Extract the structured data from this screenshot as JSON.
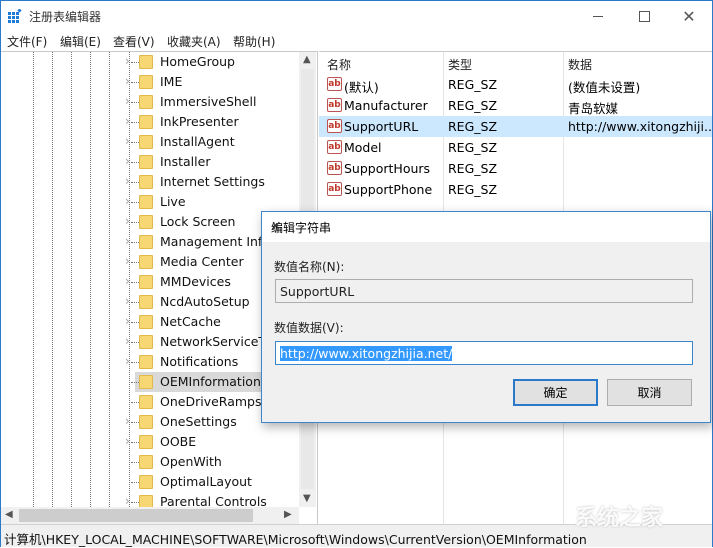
{
  "window": {
    "title": "注册表编辑器",
    "icon": "regedit-icon",
    "controls": [
      "minimize-icon",
      "maximize-icon",
      "close-icon"
    ]
  },
  "menu": [
    "文件(F)",
    "编辑(E)",
    "查看(V)",
    "收藏夹(A)",
    "帮助(H)"
  ],
  "tree": {
    "items": [
      {
        "label": "HomeGroup",
        "expandable": true
      },
      {
        "label": "IME",
        "expandable": true
      },
      {
        "label": "ImmersiveShell",
        "expandable": true
      },
      {
        "label": "InkPresenter",
        "expandable": true
      },
      {
        "label": "InstallAgent",
        "expandable": true
      },
      {
        "label": "Installer",
        "expandable": true
      },
      {
        "label": "Internet Settings",
        "expandable": true
      },
      {
        "label": "Live",
        "expandable": true
      },
      {
        "label": "Lock Screen",
        "expandable": true
      },
      {
        "label": "Management Infr",
        "expandable": true
      },
      {
        "label": "Media Center",
        "expandable": true
      },
      {
        "label": "MMDevices",
        "expandable": true
      },
      {
        "label": "NcdAutoSetup",
        "expandable": true
      },
      {
        "label": "NetCache",
        "expandable": true
      },
      {
        "label": "NetworkServiceTr",
        "expandable": true
      },
      {
        "label": "Notifications",
        "expandable": true
      },
      {
        "label": "OEMInformation",
        "expandable": false,
        "selected": true
      },
      {
        "label": "OneDriveRamps",
        "expandable": false
      },
      {
        "label": "OneSettings",
        "expandable": true
      },
      {
        "label": "OOBE",
        "expandable": true
      },
      {
        "label": "OpenWith",
        "expandable": false
      },
      {
        "label": "OptimalLayout",
        "expandable": false
      },
      {
        "label": "Parental Controls",
        "expandable": true
      }
    ]
  },
  "list": {
    "headers": [
      "名称",
      "类型",
      "数据"
    ],
    "rows": [
      {
        "name": "(默认)",
        "type": "REG_SZ",
        "data": "(数值未设置)"
      },
      {
        "name": "Manufacturer",
        "type": "REG_SZ",
        "data": "青岛软媒"
      },
      {
        "name": "SupportURL",
        "type": "REG_SZ",
        "data": "http://www.xitongzhiji...",
        "selected": true
      },
      {
        "name": "Model",
        "type": "REG_SZ",
        "data": ""
      },
      {
        "name": "SupportHours",
        "type": "REG_SZ",
        "data": ""
      },
      {
        "name": "SupportPhone",
        "type": "REG_SZ",
        "data": ""
      }
    ]
  },
  "status_path": "计算机\\HKEY_LOCAL_MACHINE\\SOFTWARE\\Microsoft\\Windows\\CurrentVersion\\OEMInformation",
  "dialog": {
    "title": "编辑字符串",
    "name_label": "数值名称(N):",
    "name_value": "SupportURL",
    "data_label": "数值数据(V):",
    "data_value": "http://www.xitongzhijia.net/",
    "ok_label": "确定",
    "cancel_label": "取消"
  },
  "watermark": "系统之家"
}
